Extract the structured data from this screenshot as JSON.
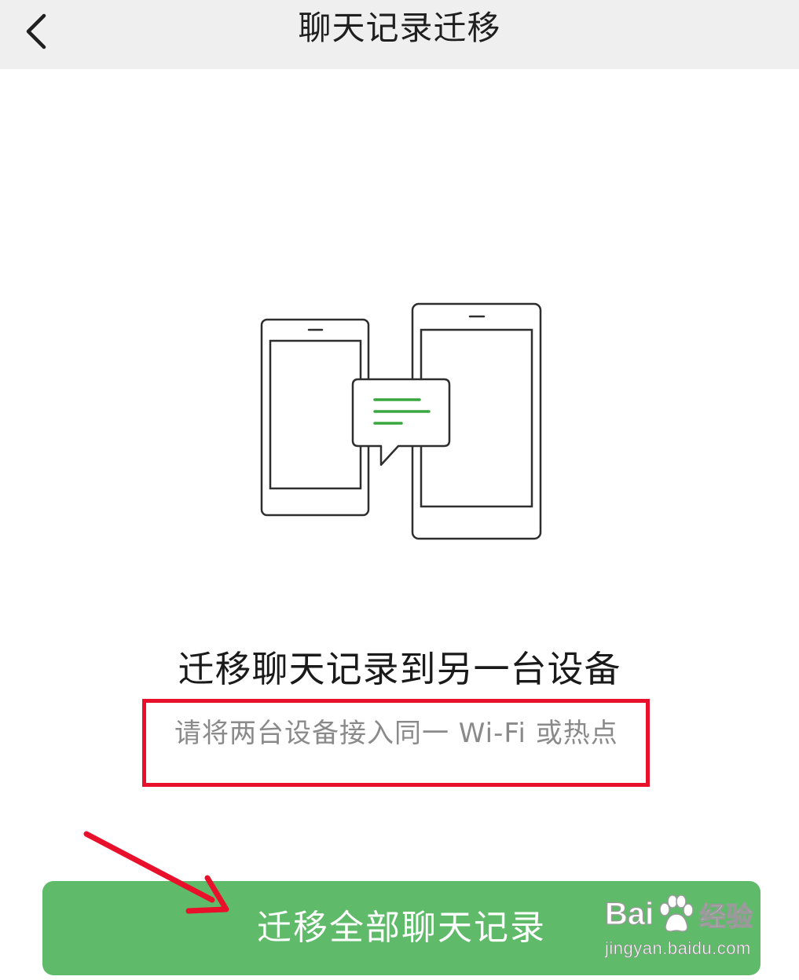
{
  "nav": {
    "title": "聊天记录迁移",
    "back_icon": "chevron-left-icon"
  },
  "illustration": {
    "icons": [
      "phone-icon",
      "tablet-icon",
      "chat-bubble-icon"
    ],
    "accent_color": "#3aa63f"
  },
  "main": {
    "headline": "迁移聊天记录到另一台设备",
    "hint": "请将两台设备接入同一 Wi-Fi 或热点",
    "button_label": "迁移全部聊天记录",
    "button_color": "#5fbb6a",
    "highlight_color": "#e8102a"
  },
  "watermark": {
    "brand_prefix": "Bai",
    "brand_suffix": "du",
    "product": "经验",
    "url": "jingyan.baidu.com"
  }
}
